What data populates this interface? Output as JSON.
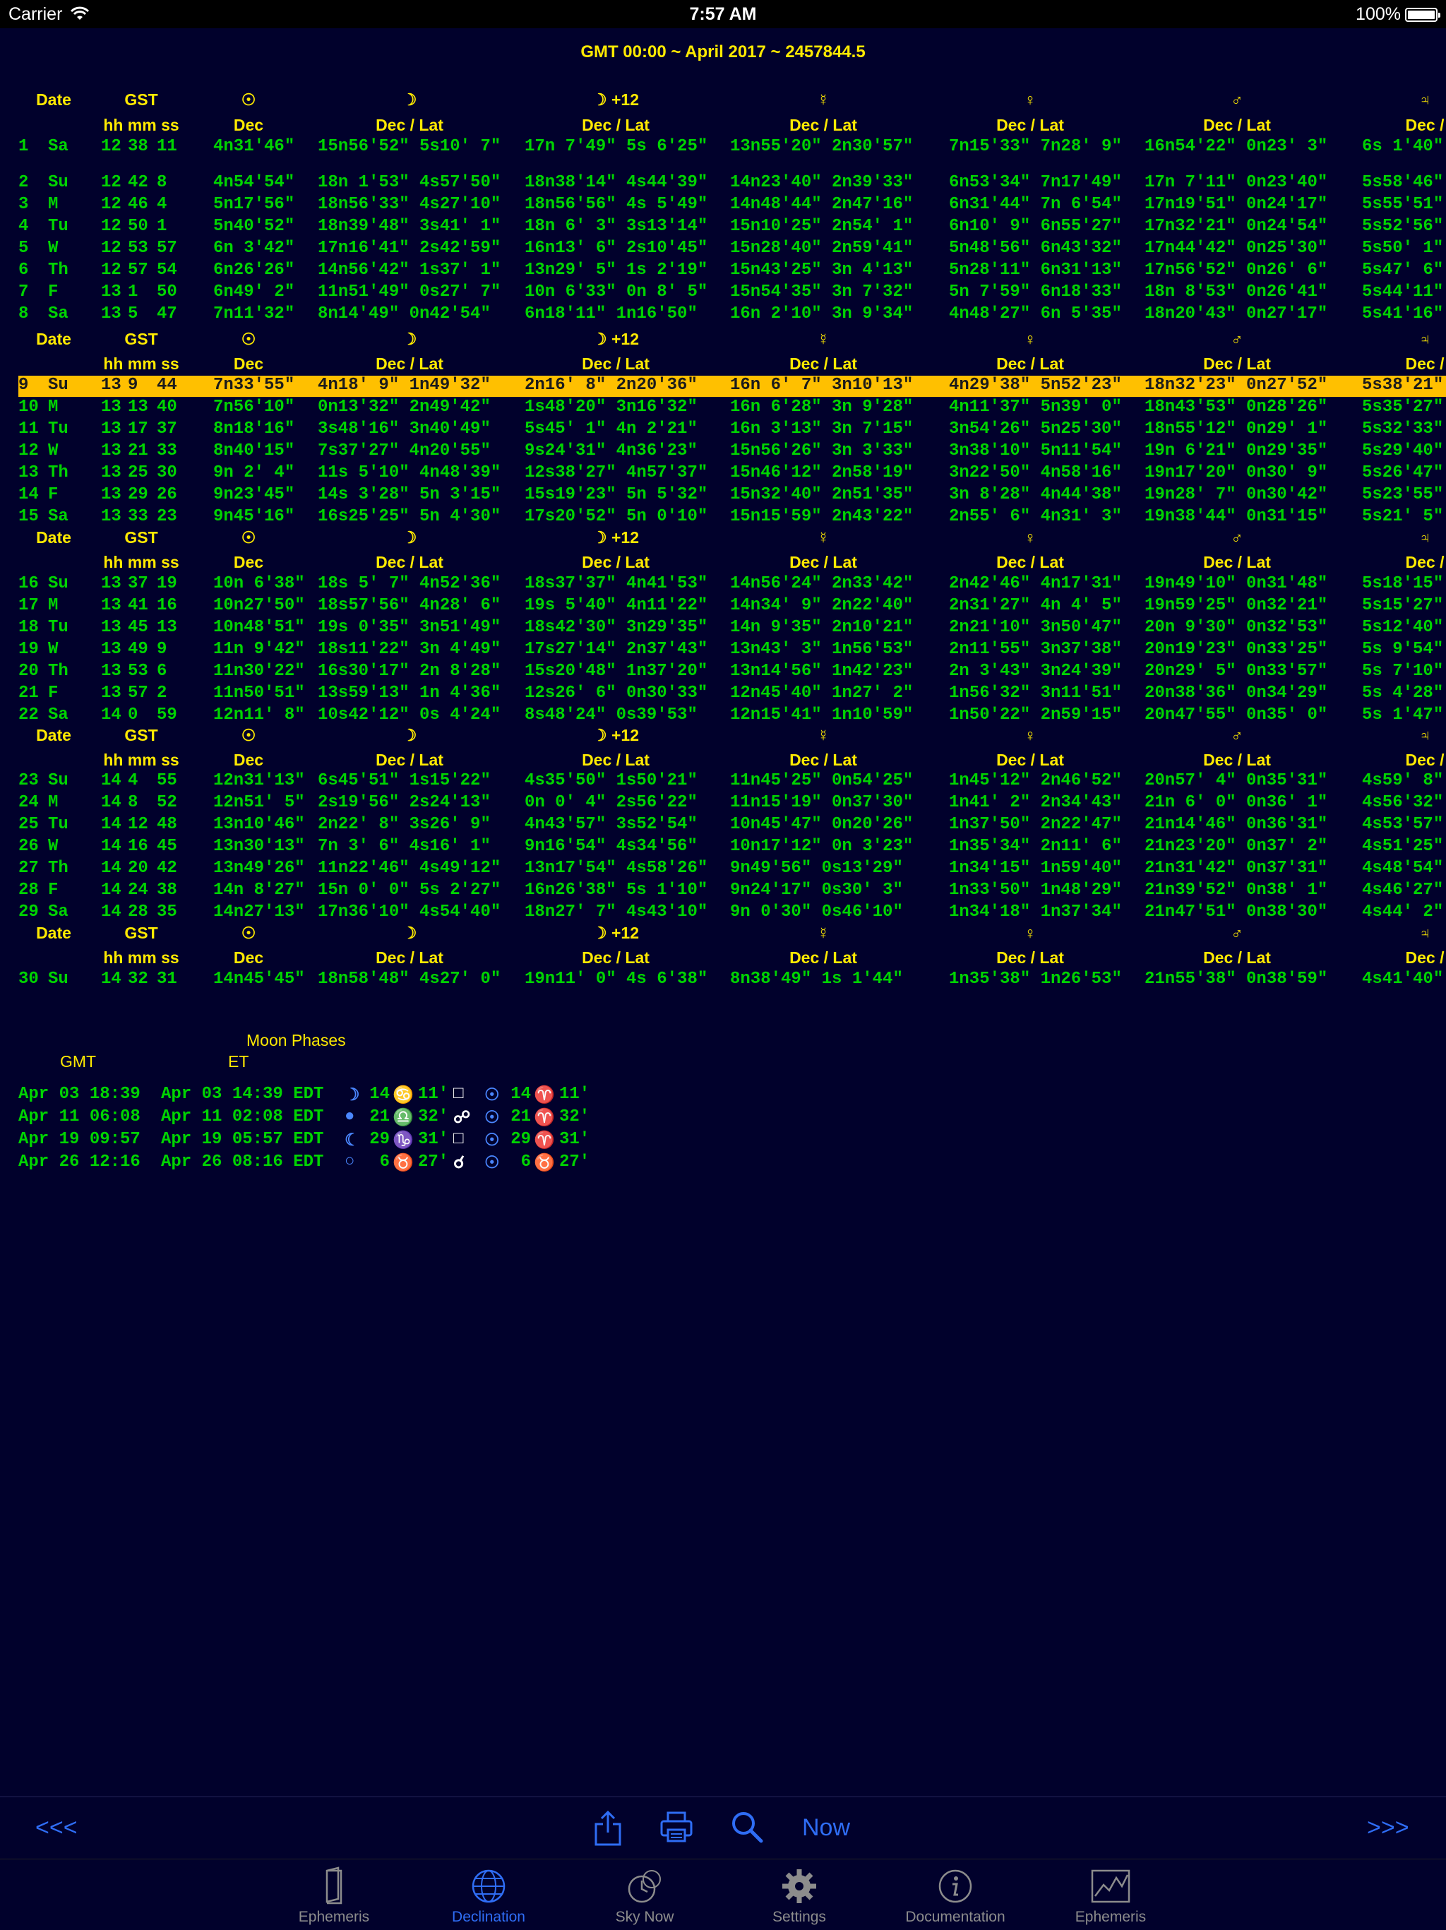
{
  "status": {
    "carrier": "Carrier",
    "time": "7:57 AM",
    "battery": "100%"
  },
  "title": "GMT 00:00 ~ April 2017 ~ 2457844.5",
  "sym": {
    "sun": "☉",
    "moon": "☽",
    "moon12": "☽ +12",
    "mercury": "☿",
    "venus": "♀",
    "mars": "♂"
  },
  "hdr": {
    "date": "Date",
    "gst": "GST",
    "hms": "hh mm ss",
    "dec": "Dec",
    "declat": "Dec / Lat",
    "dec_cut": "Dec /",
    "partial": "♃"
  },
  "rows": [
    {
      "d": "1",
      "w": "Sa",
      "h": "12",
      "m": "38",
      "s": "11",
      "sun": "4n31'46\"",
      "moon": "15n56'52\" 5s10' 7\"",
      "moon12": "17n 7'49\" 5s 6'25\"",
      "mer": "13n55'20\" 2n30'57\"",
      "ven": "7n15'33\" 7n28' 9\"",
      "mar": "16n54'22\" 0n23' 3\"",
      "jup": "6s 1'40\""
    },
    {
      "d": "2",
      "w": "Su",
      "h": "12",
      "m": "42",
      "s": "8",
      "sun": "4n54'54\"",
      "moon": "18n 1'53\" 4s57'50\"",
      "moon12": "18n38'14\" 4s44'39\"",
      "mer": "14n23'40\" 2n39'33\"",
      "ven": "6n53'34\" 7n17'49\"",
      "mar": "17n 7'11\" 0n23'40\"",
      "jup": "5s58'46\""
    },
    {
      "d": "3",
      "w": "M",
      "h": "12",
      "m": "46",
      "s": "4",
      "sun": "5n17'56\"",
      "moon": "18n56'33\" 4s27'10\"",
      "moon12": "18n56'56\" 4s 5'49\"",
      "mer": "14n48'44\" 2n47'16\"",
      "ven": "6n31'44\" 7n 6'54\"",
      "mar": "17n19'51\" 0n24'17\"",
      "jup": "5s55'51\""
    },
    {
      "d": "4",
      "w": "Tu",
      "h": "12",
      "m": "50",
      "s": "1",
      "sun": "5n40'52\"",
      "moon": "18n39'48\" 3s41' 1\"",
      "moon12": "18n 6' 3\" 3s13'14\"",
      "mer": "15n10'25\" 2n54' 1\"",
      "ven": "6n10' 9\" 6n55'27\"",
      "mar": "17n32'21\" 0n24'54\"",
      "jup": "5s52'56\""
    },
    {
      "d": "5",
      "w": "W",
      "h": "12",
      "m": "53",
      "s": "57",
      "sun": "6n 3'42\"",
      "moon": "17n16'41\" 2s42'59\"",
      "moon12": "16n13' 6\" 2s10'45\"",
      "mer": "15n28'40\" 2n59'41\"",
      "ven": "5n48'56\" 6n43'32\"",
      "mar": "17n44'42\" 0n25'30\"",
      "jup": "5s50' 1\""
    },
    {
      "d": "6",
      "w": "Th",
      "h": "12",
      "m": "57",
      "s": "54",
      "sun": "6n26'26\"",
      "moon": "14n56'42\" 1s37' 1\"",
      "moon12": "13n29' 5\" 1s 2'19\"",
      "mer": "15n43'25\" 3n 4'13\"",
      "ven": "5n28'11\" 6n31'13\"",
      "mar": "17n56'52\" 0n26' 6\"",
      "jup": "5s47' 6\""
    },
    {
      "d": "7",
      "w": "F",
      "h": "13",
      "m": "1",
      "s": "50",
      "sun": "6n49' 2\"",
      "moon": "11n51'49\" 0s27' 7\"",
      "moon12": "10n 6'33\" 0n 8' 5\"",
      "mer": "15n54'35\" 3n 7'32\"",
      "ven": "5n 7'59\" 6n18'33\"",
      "mar": "18n 8'53\" 0n26'41\"",
      "jup": "5s44'11\""
    },
    {
      "d": "8",
      "w": "Sa",
      "h": "13",
      "m": "5",
      "s": "47",
      "sun": "7n11'32\"",
      "moon": "8n14'49\" 0n42'54\"",
      "moon12": "6n18'11\" 1n16'50\"",
      "mer": "16n 2'10\" 3n 9'34\"",
      "ven": "4n48'27\" 6n 5'35\"",
      "mar": "18n20'43\" 0n27'17\"",
      "jup": "5s41'16\""
    },
    {
      "d": "9",
      "w": "Su",
      "h": "13",
      "m": "9",
      "s": "44",
      "sun": "7n33'55\"",
      "moon": "4n18' 9\" 1n49'32\"",
      "moon12": "2n16' 8\" 2n20'36\"",
      "mer": "16n 6' 7\" 3n10'13\"",
      "ven": "4n29'38\" 5n52'23\"",
      "mar": "18n32'23\" 0n27'52\"",
      "jup": "5s38'21\""
    },
    {
      "d": "10",
      "w": "M",
      "h": "13",
      "m": "13",
      "s": "40",
      "sun": "7n56'10\"",
      "moon": "0n13'32\" 2n49'42\"",
      "moon12": "1s48'20\" 3n16'32\"",
      "mer": "16n 6'28\" 3n 9'28\"",
      "ven": "4n11'37\" 5n39' 0\"",
      "mar": "18n43'53\" 0n28'26\"",
      "jup": "5s35'27\""
    },
    {
      "d": "11",
      "w": "Tu",
      "h": "13",
      "m": "17",
      "s": "37",
      "sun": "8n18'16\"",
      "moon": "3s48'16\" 3n40'49\"",
      "moon12": "5s45' 1\" 4n 2'21\"",
      "mer": "16n 3'13\" 3n 7'15\"",
      "ven": "3n54'26\" 5n25'30\"",
      "mar": "18n55'12\" 0n29' 1\"",
      "jup": "5s32'33\""
    },
    {
      "d": "12",
      "w": "W",
      "h": "13",
      "m": "21",
      "s": "33",
      "sun": "8n40'15\"",
      "moon": "7s37'27\" 4n20'55\"",
      "moon12": "9s24'31\" 4n36'23\"",
      "mer": "15n56'26\" 3n 3'33\"",
      "ven": "3n38'10\" 5n11'54\"",
      "mar": "19n 6'21\" 0n29'35\"",
      "jup": "5s29'40\""
    },
    {
      "d": "13",
      "w": "Th",
      "h": "13",
      "m": "25",
      "s": "30",
      "sun": "9n 2' 4\"",
      "moon": "11s 5'10\" 4n48'39\"",
      "moon12": "12s38'27\" 4n57'37\"",
      "mer": "15n46'12\" 2n58'19\"",
      "ven": "3n22'50\" 4n58'16\"",
      "mar": "19n17'20\" 0n30' 9\"",
      "jup": "5s26'47\""
    },
    {
      "d": "14",
      "w": "F",
      "h": "13",
      "m": "29",
      "s": "26",
      "sun": "9n23'45\"",
      "moon": "14s 3'28\" 5n 3'15\"",
      "moon12": "15s19'23\" 5n 5'32\"",
      "mer": "15n32'40\" 2n51'35\"",
      "ven": "3n 8'28\" 4n44'38\"",
      "mar": "19n28' 7\" 0n30'42\"",
      "jup": "5s23'55\""
    },
    {
      "d": "15",
      "w": "Sa",
      "h": "13",
      "m": "33",
      "s": "23",
      "sun": "9n45'16\"",
      "moon": "16s25'25\" 5n 4'30\"",
      "moon12": "17s20'52\" 5n 0'10\"",
      "mer": "15n15'59\" 2n43'22\"",
      "ven": "2n55' 6\" 4n31' 3\"",
      "mar": "19n38'44\" 0n31'15\"",
      "jup": "5s21' 5\""
    },
    {
      "d": "16",
      "w": "Su",
      "h": "13",
      "m": "37",
      "s": "19",
      "sun": "10n 6'38\"",
      "moon": "18s 5' 7\" 4n52'36\"",
      "moon12": "18s37'37\" 4n41'53\"",
      "mer": "14n56'24\" 2n33'42\"",
      "ven": "2n42'46\" 4n17'31\"",
      "mar": "19n49'10\" 0n31'48\"",
      "jup": "5s18'15\""
    },
    {
      "d": "17",
      "w": "M",
      "h": "13",
      "m": "41",
      "s": "16",
      "sun": "10n27'50\"",
      "moon": "18s57'56\" 4n28' 6\"",
      "moon12": "19s 5'40\" 4n11'22\"",
      "mer": "14n34' 9\" 2n22'40\"",
      "ven": "2n31'27\" 4n 4' 5\"",
      "mar": "19n59'25\" 0n32'21\"",
      "jup": "5s15'27\""
    },
    {
      "d": "18",
      "w": "Tu",
      "h": "13",
      "m": "45",
      "s": "13",
      "sun": "10n48'51\"",
      "moon": "19s 0'35\" 3n51'49\"",
      "moon12": "18s42'30\" 3n29'35\"",
      "mer": "14n 9'35\" 2n10'21\"",
      "ven": "2n21'10\" 3n50'47\"",
      "mar": "20n 9'30\" 0n32'53\"",
      "jup": "5s12'40\""
    },
    {
      "d": "19",
      "w": "W",
      "h": "13",
      "m": "49",
      "s": "9",
      "sun": "11n 9'42\"",
      "moon": "18s11'22\" 3n 4'49\"",
      "moon12": "17s27'14\" 2n37'43\"",
      "mer": "13n43' 3\" 1n56'53\"",
      "ven": "2n11'55\" 3n37'38\"",
      "mar": "20n19'23\" 0n33'25\"",
      "jup": "5s 9'54\""
    },
    {
      "d": "20",
      "w": "Th",
      "h": "13",
      "m": "53",
      "s": "6",
      "sun": "11n30'22\"",
      "moon": "16s30'17\" 2n 8'28\"",
      "moon12": "15s20'48\" 1n37'20\"",
      "mer": "13n14'56\" 1n42'23\"",
      "ven": "2n 3'43\" 3n24'39\"",
      "mar": "20n29' 5\" 0n33'57\"",
      "jup": "5s 7'10\""
    },
    {
      "d": "21",
      "w": "F",
      "h": "13",
      "m": "57",
      "s": "2",
      "sun": "11n50'51\"",
      "moon": "13s59'13\" 1n 4'36\"",
      "moon12": "12s26' 6\" 0n30'33\"",
      "mer": "12n45'40\" 1n27' 2\"",
      "ven": "1n56'32\" 3n11'51\"",
      "mar": "20n38'36\" 0n34'29\"",
      "jup": "5s 4'28\""
    },
    {
      "d": "22",
      "w": "Sa",
      "h": "14",
      "m": "0",
      "s": "59",
      "sun": "12n11' 8\"",
      "moon": "10s42'12\" 0s 4'24\"",
      "moon12": "8s48'24\" 0s39'53\"",
      "mer": "12n15'41\" 1n10'59\"",
      "ven": "1n50'22\" 2n59'15\"",
      "mar": "20n47'55\" 0n35' 0\"",
      "jup": "5s 1'47\""
    },
    {
      "d": "23",
      "w": "Su",
      "h": "14",
      "m": "4",
      "s": "55",
      "sun": "12n31'13\"",
      "moon": "6s45'51\" 1s15'22\"",
      "moon12": "4s35'50\" 1s50'21\"",
      "mer": "11n45'25\" 0n54'25\"",
      "ven": "1n45'12\" 2n46'52\"",
      "mar": "20n57' 4\" 0n35'31\"",
      "jup": "4s59' 8\""
    },
    {
      "d": "24",
      "w": "M",
      "h": "14",
      "m": "8",
      "s": "52",
      "sun": "12n51' 5\"",
      "moon": "2s19'56\" 2s24'13\"",
      "moon12": "0n 0' 4\" 2s56'22\"",
      "mer": "11n15'19\" 0n37'30\"",
      "ven": "1n41' 2\" 2n34'43\"",
      "mar": "21n 6' 0\" 0n36' 1\"",
      "jup": "4s56'32\""
    },
    {
      "d": "25",
      "w": "Tu",
      "h": "14",
      "m": "12",
      "s": "48",
      "sun": "13n10'46\"",
      "moon": "2n22' 8\" 3s26' 9\"",
      "moon12": "4n43'57\" 3s52'54\"",
      "mer": "10n45'47\" 0n20'26\"",
      "ven": "1n37'50\" 2n22'47\"",
      "mar": "21n14'46\" 0n36'31\"",
      "jup": "4s53'57\""
    },
    {
      "d": "26",
      "w": "W",
      "h": "14",
      "m": "16",
      "s": "45",
      "sun": "13n30'13\"",
      "moon": "7n 3' 6\" 4s16' 1\"",
      "moon12": "9n16'54\" 4s34'56\"",
      "mer": "10n17'12\" 0n 3'23\"",
      "ven": "1n35'34\" 2n11' 6\"",
      "mar": "21n23'20\" 0n37' 2\"",
      "jup": "4s51'25\""
    },
    {
      "d": "27",
      "w": "Th",
      "h": "14",
      "m": "20",
      "s": "42",
      "sun": "13n49'26\"",
      "moon": "11n22'46\" 4s49'12\"",
      "moon12": "13n17'54\" 4s58'26\"",
      "mer": "9n49'56\" 0s13'29\"",
      "ven": "1n34'15\" 1n59'40\"",
      "mar": "21n31'42\" 0n37'31\"",
      "jup": "4s48'54\""
    },
    {
      "d": "28",
      "w": "F",
      "h": "14",
      "m": "24",
      "s": "38",
      "sun": "14n 8'27\"",
      "moon": "15n 0' 0\" 5s 2'27\"",
      "moon12": "16n26'38\" 5s 1'10\"",
      "mer": "9n24'17\" 0s30' 3\"",
      "ven": "1n33'50\" 1n48'29\"",
      "mar": "21n39'52\" 0n38' 1\"",
      "jup": "4s46'27\""
    },
    {
      "d": "29",
      "w": "Sa",
      "h": "14",
      "m": "28",
      "s": "35",
      "sun": "14n27'13\"",
      "moon": "17n36'10\" 4s54'40\"",
      "moon12": "18n27' 7\" 4s43'10\"",
      "mer": "9n 0'30\" 0s46'10\"",
      "ven": "1n34'18\" 1n37'34\"",
      "mar": "21n47'51\" 0n38'30\"",
      "jup": "4s44' 2\""
    },
    {
      "d": "30",
      "w": "Su",
      "h": "14",
      "m": "32",
      "s": "31",
      "sun": "14n45'45\"",
      "moon": "18n58'48\" 4s27' 0\"",
      "moon12": "19n11' 0\" 4s 6'38\"",
      "mer": "8n38'49\" 1s 1'44\"",
      "ven": "1n35'38\" 1n26'53\"",
      "mar": "21n55'38\" 0n38'59\"",
      "jup": "4s41'40\""
    }
  ],
  "phases": {
    "title": "Moon Phases",
    "gmt_label": "GMT",
    "et_label": "ET",
    "rows": [
      {
        "gmt": "Apr 03 18:39",
        "et": "Apr 03 14:39 EDT",
        "phase": "☽",
        "deg": "14",
        "sign": "♋",
        "min": "11'",
        "aspect": "□",
        "sun": "☉",
        "sdeg": "14",
        "ssign": "♈",
        "smin": "11'"
      },
      {
        "gmt": "Apr 11 06:08",
        "et": "Apr 11 02:08 EDT",
        "phase": "●",
        "deg": "21",
        "sign": "♎",
        "min": "32'",
        "aspect": "☍",
        "sun": "☉",
        "sdeg": "21",
        "ssign": "♈",
        "smin": "32'"
      },
      {
        "gmt": "Apr 19 09:57",
        "et": "Apr 19 05:57 EDT",
        "phase": "☾",
        "deg": "29",
        "sign": "♑",
        "min": "31'",
        "aspect": "□",
        "sun": "☉",
        "sdeg": "29",
        "ssign": "♈",
        "smin": "31'"
      },
      {
        "gmt": "Apr 26 12:16",
        "et": "Apr 26 08:16 EDT",
        "phase": "○",
        "deg": "6",
        "sign": "♉",
        "min": "27'",
        "aspect": "☌",
        "sun": "☉",
        "sdeg": "6",
        "ssign": "♉",
        "smin": "27'"
      }
    ]
  },
  "toolbar": {
    "prev": "<<<",
    "now": "Now",
    "next": ">>>"
  },
  "tabs": [
    "Ephemeris",
    "Declination",
    "Sky Now",
    "Settings",
    "Documentation",
    "Ephemeris"
  ],
  "colors": {
    "bg": "#01012c",
    "header": "#ffea00",
    "data": "#00d400",
    "highlight": "#ffc000",
    "accent": "#2f6df5"
  }
}
